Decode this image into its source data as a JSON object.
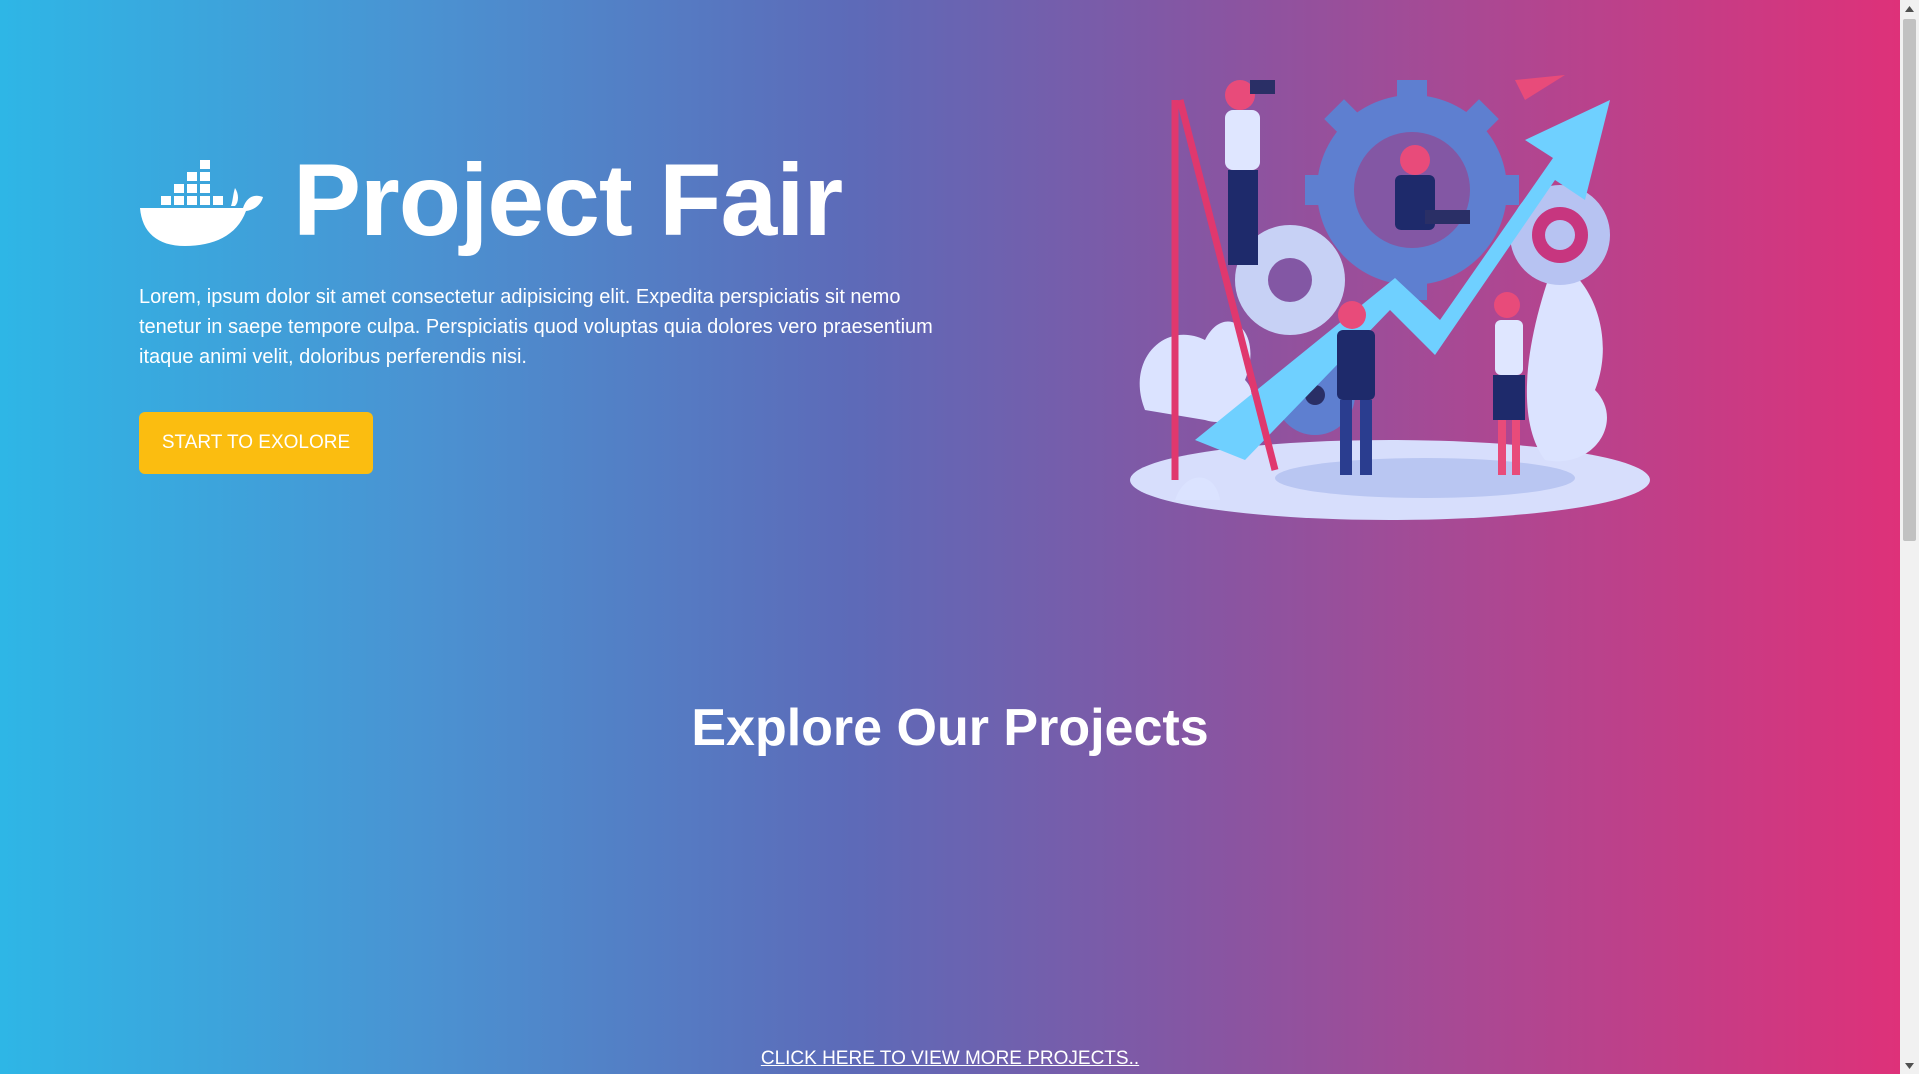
{
  "hero": {
    "title": "Project Fair",
    "description": "Lorem, ipsum dolor sit amet consectetur adipisicing elit. Expedita perspiciatis sit nemo tenetur in saepe tempore culpa. Perspiciatis quod voluptas quia dolores vero praesentium itaque animi velit, doloribus perferendis nisi.",
    "cta_label": "START TO EXOLORE",
    "logo_icon": "docker-whale-icon",
    "illustration_icon": "team-gears-growth-illustration"
  },
  "projects": {
    "heading": "Explore Our Projects",
    "more_link": "CLICK HERE TO VIEW MORE PROJECTS.."
  },
  "colors": {
    "gradient_start": "#2eb6e6",
    "gradient_mid": "#5d6ab8",
    "gradient_end": "#de3179",
    "button": "#fbbd10",
    "text": "#ffffff"
  },
  "scrollbar": {
    "position_fraction": 0.0
  }
}
